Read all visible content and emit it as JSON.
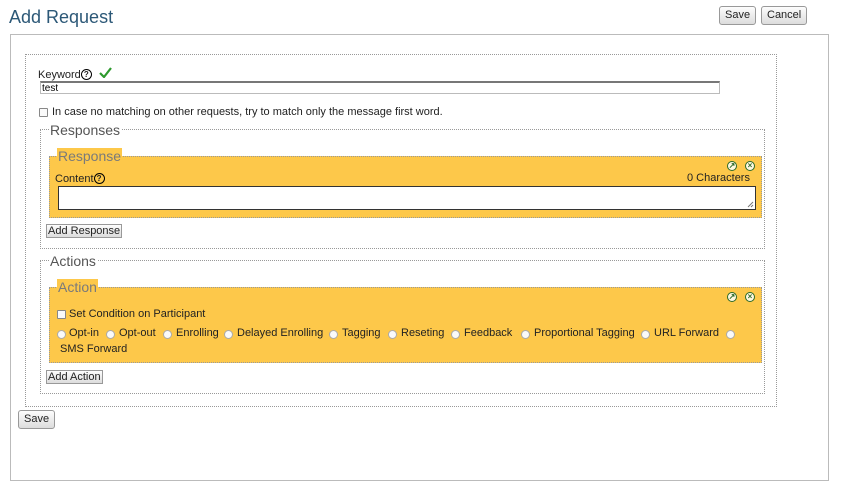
{
  "page": {
    "title": "Add Request"
  },
  "header": {
    "save_label": "Save",
    "cancel_label": "Cancel"
  },
  "keyword": {
    "label": "Keyword",
    "help": "?",
    "value": "test",
    "valid_icon": "check-icon"
  },
  "first_word_option": {
    "label": "In case no matching on other requests, try to match only the message first word."
  },
  "responses": {
    "legend": "Responses",
    "response": {
      "legend": "Response",
      "content_label": "Content",
      "help": "?",
      "char_count": "0 Characters"
    },
    "add_label": "Add Response"
  },
  "actions": {
    "legend": "Actions",
    "action": {
      "legend": "Action",
      "condition_label": "Set Condition on Participant",
      "types": [
        "Opt-in",
        "Opt-out",
        "Enrolling",
        "Delayed Enrolling",
        "Tagging",
        "Reseting",
        "Feedback",
        "Proportional Tagging",
        "URL Forward",
        "SMS Forward"
      ]
    },
    "add_label": "Add Action"
  },
  "footer": {
    "save_label": "Save"
  },
  "colors": {
    "accent_panel": "#fdc84a",
    "title": "#2c5877"
  }
}
